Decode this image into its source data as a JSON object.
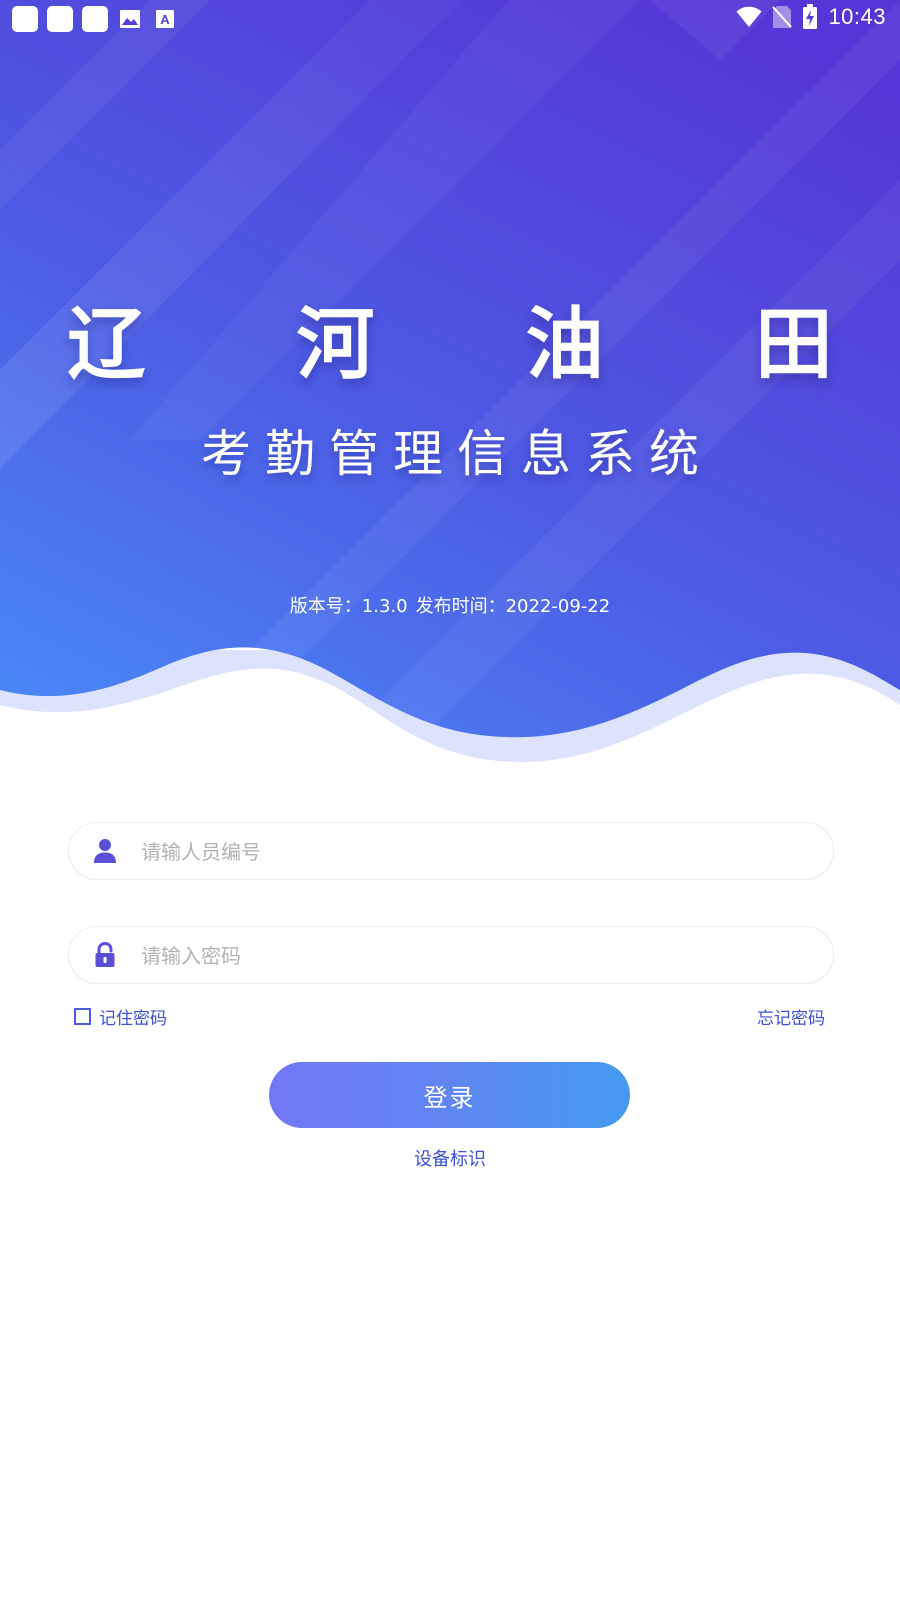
{
  "status_bar": {
    "time": "10:43",
    "left_icons": [
      "notification-box-icon",
      "notification-box-icon",
      "notification-box-icon",
      "image-icon",
      "font-icon"
    ],
    "right_icons": [
      "wifi-icon",
      "no-sim-icon",
      "battery-charging-icon"
    ]
  },
  "header": {
    "title": "辽 河 油 田",
    "subtitle": "考勤管理信息系统",
    "version_label": "版本号：1.3.0",
    "release_label": "发布时间：2022-09-22"
  },
  "form": {
    "username_placeholder": "请输人员编号",
    "password_placeholder": "请输入密码",
    "remember_label": "记住密码",
    "remember_checked": false,
    "forgot_label": "忘记密码",
    "login_label": "登录",
    "device_id_label": "设备标识"
  },
  "colors": {
    "brand_blue": "#4a5de0",
    "link_blue": "#3e51d6",
    "hero_top": "#5a3fdc",
    "hero_bottom": "#4e84f5",
    "button_start": "#7377f6",
    "button_end": "#4499ef"
  }
}
